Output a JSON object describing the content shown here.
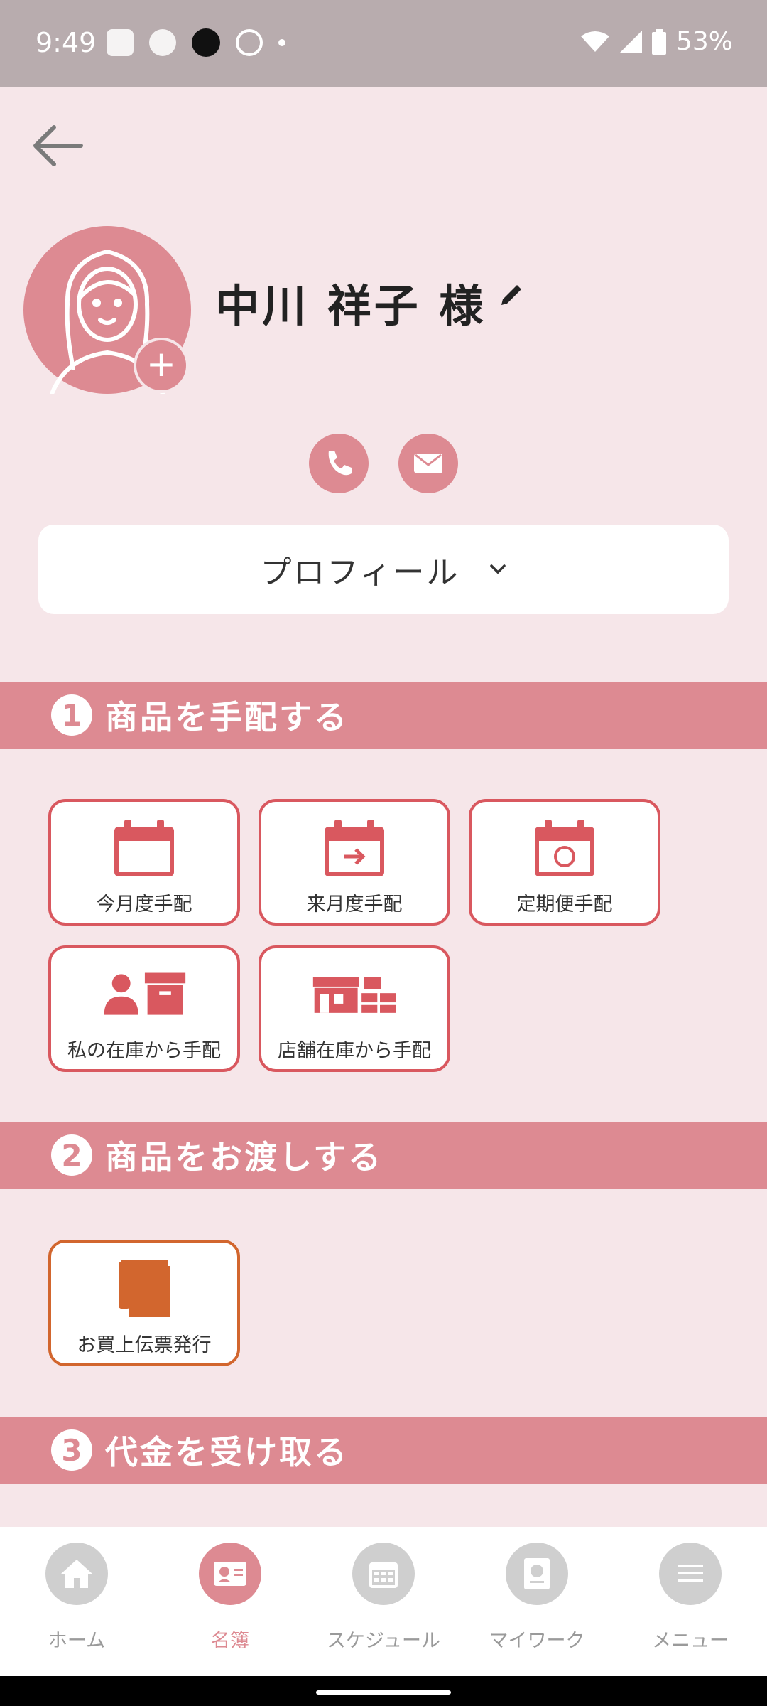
{
  "status_bar": {
    "time": "9:49",
    "battery": "53%"
  },
  "customer": {
    "name": "中川 祥子 様"
  },
  "profile": {
    "label": "プロフィール"
  },
  "sections": [
    {
      "num": "1",
      "title": "商品を手配する",
      "tiles": [
        {
          "label": "今月度手配",
          "icon": "calendar-icon"
        },
        {
          "label": "来月度手配",
          "icon": "calendar-arrow-icon"
        },
        {
          "label": "定期便手配",
          "icon": "calendar-refresh-icon"
        },
        {
          "label": "私の在庫から手配",
          "icon": "person-box-icon"
        },
        {
          "label": "店舗在庫から手配",
          "icon": "store-boxes-icon"
        }
      ]
    },
    {
      "num": "2",
      "title": "商品をお渡しする",
      "tiles": [
        {
          "label": "お買上伝票発行",
          "icon": "receipt-book-icon"
        }
      ]
    },
    {
      "num": "3",
      "title": "代金を受け取る"
    }
  ],
  "tabs": [
    {
      "label": "ホーム",
      "icon": "home-icon"
    },
    {
      "label": "名簿",
      "icon": "contact-card-icon",
      "active": true
    },
    {
      "label": "スケジュール",
      "icon": "calendar-icon"
    },
    {
      "label": "マイワーク",
      "icon": "report-icon"
    },
    {
      "label": "メニュー",
      "icon": "menu-icon"
    }
  ],
  "colors": {
    "accent": "#dd8a92",
    "tile_border": "#d9585f",
    "orange": "#d2662e",
    "background": "#f6e6e9"
  }
}
